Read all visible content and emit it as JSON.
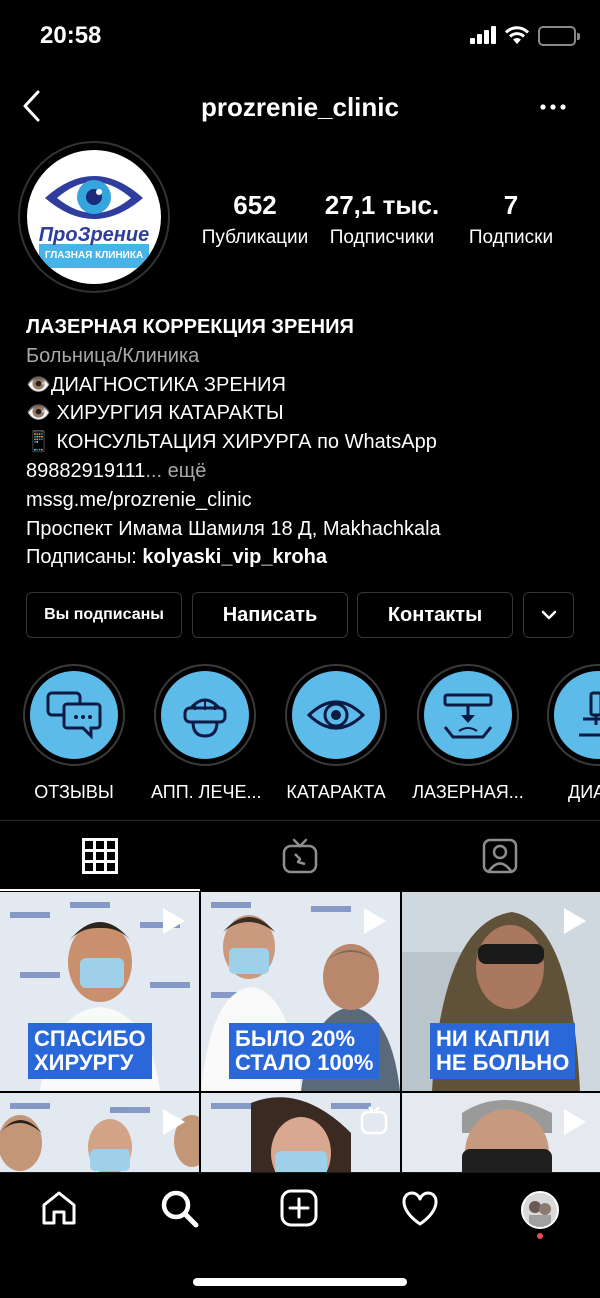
{
  "status": {
    "time": "20:58"
  },
  "header": {
    "username": "prozrenie_clinic"
  },
  "avatar": {
    "brand": "ПроЗрение",
    "subtitle": "ГЛАЗНАЯ КЛИНИКА"
  },
  "stats": [
    {
      "value": "652",
      "label": "Публикации"
    },
    {
      "value": "27,1 тыс.",
      "label": "Подписчики"
    },
    {
      "value": "7",
      "label": "Подписки"
    }
  ],
  "bio": {
    "name": "ЛАЗЕРНАЯ КОРРЕКЦИЯ ЗРЕНИЯ",
    "category": "Больница/Клиника",
    "line1": "👁️ДИАГНОСТИКА ЗРЕНИЯ",
    "line2": "👁️ ХИРУРГИЯ КАТАРАКТЫ",
    "line3": "📱 КОНСУЛЬТАЦИЯ ХИРУРГА по WhatsApp",
    "phone": "89882919111",
    "more": "... ещё",
    "link": "mssg.me/prozrenie_clinic",
    "address": "Проспект Имама Шамиля 18 Д, Makhachkala",
    "followed_prefix": "Подписаны: ",
    "followed_by": "kolyaski_vip_kroha"
  },
  "actions": {
    "following": "Вы подписаны",
    "message": "Написать",
    "contacts": "Контакты"
  },
  "highlights": [
    {
      "label": "ОТЗЫВЫ",
      "icon": "chat-bubbles-icon"
    },
    {
      "label": "АПП. ЛЕЧЕ...",
      "icon": "vr-headset-icon"
    },
    {
      "label": "КАТАРАКТА",
      "icon": "eye-icon"
    },
    {
      "label": "ЛАЗЕРНАЯ...",
      "icon": "laser-icon"
    },
    {
      "label": "ДИАГН",
      "icon": "microscope-icon"
    }
  ],
  "tabs": [
    "grid-icon",
    "igtv-icon",
    "tagged-icon"
  ],
  "posts": [
    {
      "caption": "СПАСИБО\nХИРУРГУ",
      "type": "reel"
    },
    {
      "caption": "БЫЛО 20%\nСТАЛО 100%",
      "type": "reel"
    },
    {
      "caption": "НИ КАПЛИ\nНЕ БОЛЬНО",
      "type": "reel"
    },
    {
      "caption": "",
      "type": "reel"
    },
    {
      "caption": "",
      "type": "igtv"
    },
    {
      "caption": "",
      "type": "reel"
    }
  ],
  "colors": {
    "accent": "#5dbbea",
    "banner": "#2a67d8",
    "notification": "#ed4956"
  },
  "bottom_nav": [
    "home-icon",
    "search-icon",
    "new-post-icon",
    "activity-heart-icon",
    "profile-avatar"
  ]
}
